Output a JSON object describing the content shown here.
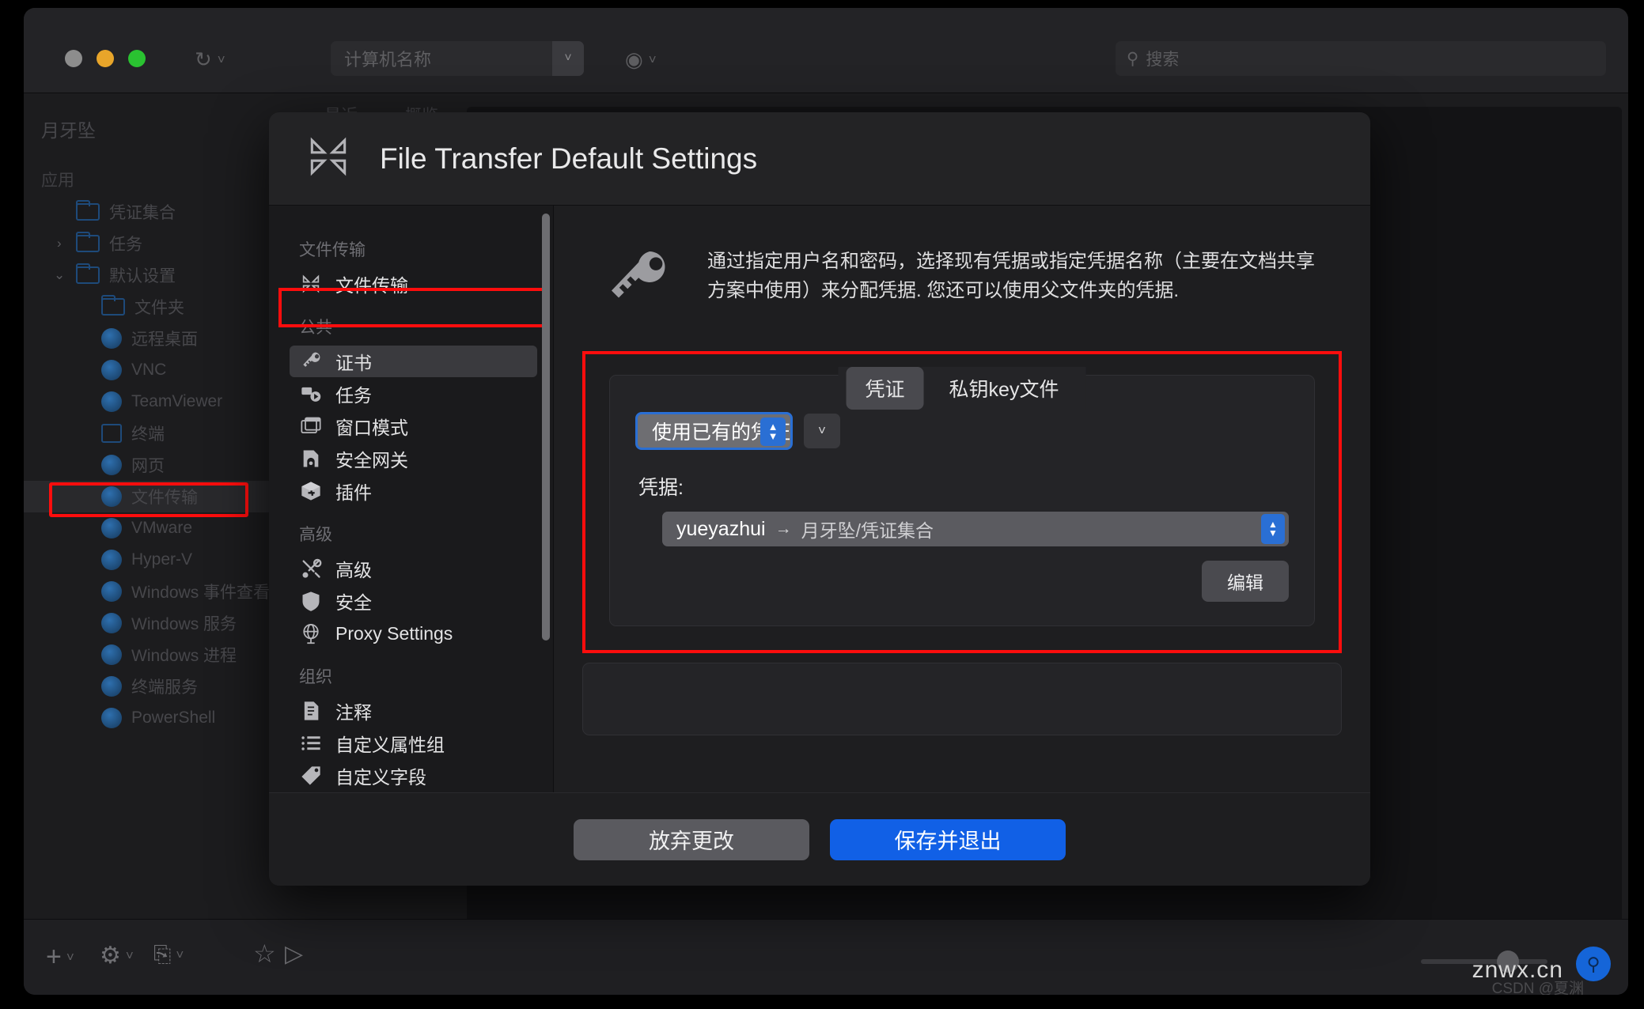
{
  "app": {
    "toolbar": {
      "computer_name_placeholder": "计算机名称",
      "search_placeholder": "搜索",
      "refresh_icon": "refresh-icon",
      "record_icon": "record-icon"
    },
    "tabs": [
      "最近",
      "概览"
    ],
    "sidebar": {
      "workspace": "月牙坠",
      "groups": [
        {
          "label": "应用",
          "items": [
            {
              "label": "凭证集合",
              "icon": "folder-icon",
              "indent": 1,
              "disclosure": ""
            },
            {
              "label": "任务",
              "icon": "folder-icon",
              "indent": 1,
              "disclosure": "›"
            },
            {
              "label": "默认设置",
              "icon": "folder-icon",
              "indent": 1,
              "disclosure": "⌄"
            },
            {
              "label": "文件夹",
              "icon": "folder-icon",
              "indent": 2,
              "disclosure": ""
            },
            {
              "label": "远程桌面",
              "icon": "cube-icon",
              "indent": 2,
              "disclosure": ""
            },
            {
              "label": "VNC",
              "icon": "cube-icon",
              "indent": 2,
              "disclosure": ""
            },
            {
              "label": "TeamViewer",
              "icon": "cube-icon",
              "indent": 2,
              "disclosure": ""
            },
            {
              "label": "终端",
              "icon": "terminal-icon",
              "indent": 2,
              "disclosure": ""
            },
            {
              "label": "网页",
              "icon": "cube-icon",
              "indent": 2,
              "disclosure": ""
            },
            {
              "label": "文件传输",
              "icon": "cube-icon",
              "indent": 2,
              "disclosure": "",
              "highlighted": true
            },
            {
              "label": "VMware",
              "icon": "cube-icon",
              "indent": 2,
              "disclosure": ""
            },
            {
              "label": "Hyper-V",
              "icon": "cube-icon",
              "indent": 2,
              "disclosure": ""
            },
            {
              "label": "Windows 事件查看",
              "icon": "cube-icon",
              "indent": 2,
              "disclosure": ""
            },
            {
              "label": "Windows 服务",
              "icon": "cube-icon",
              "indent": 2,
              "disclosure": ""
            },
            {
              "label": "Windows 进程",
              "icon": "cube-icon",
              "indent": 2,
              "disclosure": ""
            },
            {
              "label": "终端服务",
              "icon": "cube-icon",
              "indent": 2,
              "disclosure": ""
            },
            {
              "label": "PowerShell",
              "icon": "cube-icon",
              "indent": 2,
              "disclosure": ""
            }
          ]
        }
      ]
    },
    "bottombar": {
      "add_icon": "plus-icon",
      "settings_icon": "gear-icon",
      "transfer_icon": "sync-arrows-icon",
      "favorite_icon": "star-icon",
      "play_icon": "play-icon"
    },
    "watermark": "znwx.cn",
    "watermark_sub": "CSDN @夏渊"
  },
  "dialog": {
    "title": "File Transfer Default Settings",
    "title_icon": "file-transfer-icon",
    "nav": [
      {
        "type": "group",
        "label": "文件传输"
      },
      {
        "type": "item",
        "label": "文件传输",
        "icon": "file-transfer-icon",
        "selected": false
      },
      {
        "type": "group",
        "label": "公共"
      },
      {
        "type": "item",
        "label": "证书",
        "icon": "key-icon",
        "selected": true
      },
      {
        "type": "item",
        "label": "任务",
        "icon": "tasks-icon",
        "selected": false
      },
      {
        "type": "item",
        "label": "窗口模式",
        "icon": "window-icon",
        "selected": false
      },
      {
        "type": "item",
        "label": "安全网关",
        "icon": "gateway-icon",
        "selected": false
      },
      {
        "type": "item",
        "label": "插件",
        "icon": "plugin-box-icon",
        "selected": false
      },
      {
        "type": "group",
        "label": "高级"
      },
      {
        "type": "item",
        "label": "高级",
        "icon": "tools-icon",
        "selected": false
      },
      {
        "type": "item",
        "label": "安全",
        "icon": "shield-icon",
        "selected": false
      },
      {
        "type": "item",
        "label": "Proxy Settings",
        "icon": "globe-icon",
        "selected": false
      },
      {
        "type": "group",
        "label": "组织"
      },
      {
        "type": "item",
        "label": "注释",
        "icon": "note-icon",
        "selected": false
      },
      {
        "type": "item",
        "label": "自定义属性组",
        "icon": "list-icon",
        "selected": false
      },
      {
        "type": "item",
        "label": "自定义字段",
        "icon": "tag-icon",
        "selected": false
      }
    ],
    "main": {
      "description": "通过指定用户名和密码，选择现有凭据或指定凭据名称（主要在文档共享方案中使用）来分配凭据. 您还可以使用父文件夹的凭据.",
      "description_icon": "key-icon",
      "tabs": [
        {
          "label": "凭证",
          "active": true
        },
        {
          "label": "私钥key文件",
          "active": false
        }
      ],
      "mode_select_value": "使用已有的凭证",
      "credential_label": "凭据:",
      "credential_name": "yueyazhui",
      "credential_arrow": "→",
      "credential_path": "月牙坠/凭证集合",
      "edit_button": "编辑"
    },
    "footer": {
      "discard_label": "放弃更改",
      "save_label": "保存并退出"
    }
  },
  "colors": {
    "accent_blue": "#1160e6",
    "highlight_red": "#fd0d0d",
    "dialog_bg": "#1e1e20",
    "nav_bg": "#1a1a1c"
  }
}
